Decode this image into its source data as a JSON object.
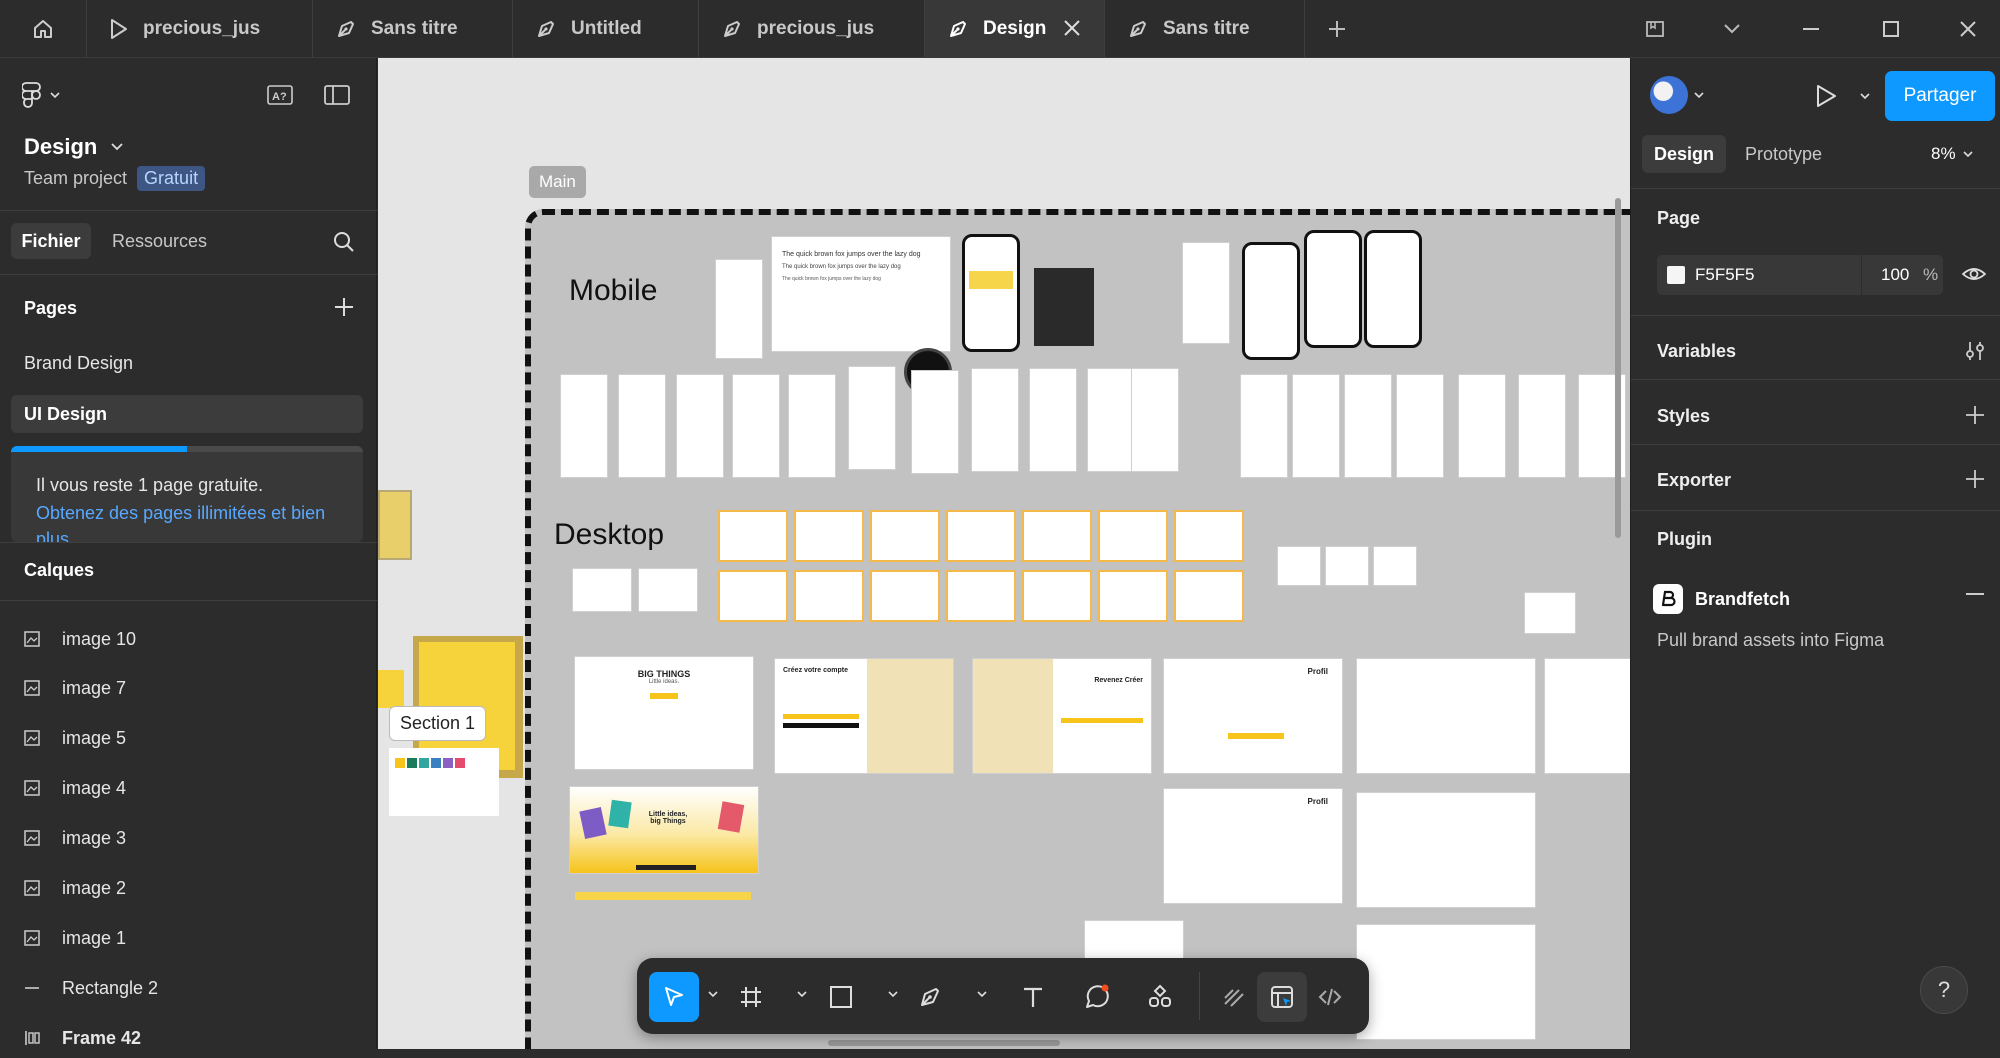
{
  "tabs": [
    {
      "label": "precious_jus",
      "kind": "play"
    },
    {
      "label": "Sans titre",
      "kind": "pen"
    },
    {
      "label": "Untitled",
      "kind": "pen"
    },
    {
      "label": "precious_jus",
      "kind": "pen"
    },
    {
      "label": "Design",
      "kind": "pen",
      "active": true
    },
    {
      "label": "Sans titre",
      "kind": "pen"
    }
  ],
  "file": {
    "name": "Design",
    "team": "Team project",
    "plan_badge": "Gratuit"
  },
  "left_tabs": {
    "file": "Fichier",
    "resources": "Ressources"
  },
  "pages": {
    "title": "Pages",
    "items": [
      "Brand Design",
      "UI Design"
    ],
    "selected": "UI Design",
    "usage_progress": 0.5
  },
  "upsell": {
    "text": "Il vous reste 1 page gratuite.",
    "link": "Obtenez des pages illimitées et bien plus"
  },
  "layers": {
    "title": "Calques",
    "items": [
      {
        "name": "image 10",
        "type": "image"
      },
      {
        "name": "image 7",
        "type": "image"
      },
      {
        "name": "image 5",
        "type": "image"
      },
      {
        "name": "image 4",
        "type": "image"
      },
      {
        "name": "image 3",
        "type": "image"
      },
      {
        "name": "image 2",
        "type": "image"
      },
      {
        "name": "image 1",
        "type": "image"
      },
      {
        "name": "Rectangle 2",
        "type": "rectangle"
      },
      {
        "name": "Frame 42",
        "type": "frame"
      }
    ]
  },
  "canvas": {
    "frame_label": "Main",
    "section_label": "Section 1",
    "mobile_label": "Mobile",
    "desktop_label": "Desktop",
    "sample_text": "The quick brown fox jumps over the lazy dog",
    "hero_title": "BIG THINGS",
    "hero_sub": "Little ideas.",
    "signup_title": "Créez votre compte",
    "login_title": "Revenez Créer",
    "profile_title": "Profil",
    "banner_title": "Little ideas, big Things"
  },
  "right": {
    "share_label": "Partager",
    "tabs": {
      "design": "Design",
      "prototype": "Prototype"
    },
    "zoom": "8%",
    "page_section": "Page",
    "page_color": "F5F5F5",
    "page_opacity": "100",
    "percent": "%",
    "variables": "Variables",
    "styles": "Styles",
    "export": "Exporter",
    "plugin": "Plugin",
    "plugin_name": "Brandfetch",
    "plugin_desc": "Pull brand assets into Figma"
  },
  "colors": {
    "accent": "#0d99ff",
    "badge": "#3e5683",
    "canvas": "#e5e5e5",
    "frame": "#c2c2c2",
    "brand_yellow": "#f7d54a"
  },
  "help_label": "?"
}
